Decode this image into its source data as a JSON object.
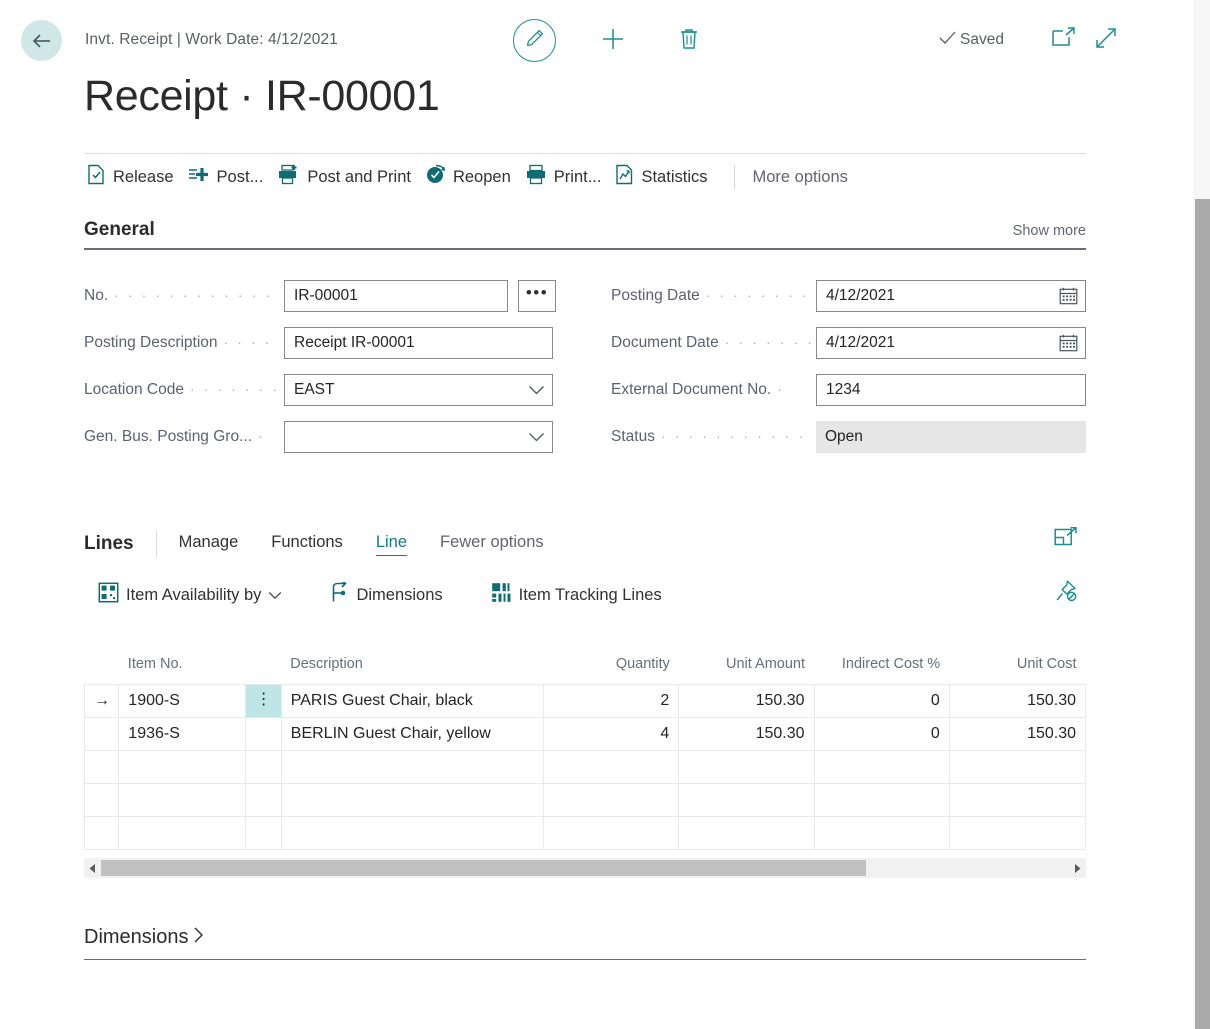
{
  "header": {
    "breadcrumb": "Invt. Receipt | Work Date: 4/12/2021",
    "title": "Receipt · IR-00001",
    "saved_label": "Saved",
    "back_icon": "back-arrow-icon",
    "edit_icon": "pencil-icon",
    "new_icon": "plus-icon",
    "delete_icon": "trash-icon",
    "open_new_window_icon": "open-in-new-window-icon",
    "fullscreen_icon": "expand-focus-icon"
  },
  "ribbon": {
    "actions": [
      {
        "label": "Release",
        "icon": "release-document-icon"
      },
      {
        "label": "Post...",
        "icon": "post-icon"
      },
      {
        "label": "Post and Print",
        "icon": "post-and-print-icon"
      },
      {
        "label": "Reopen",
        "icon": "reopen-icon"
      },
      {
        "label": "Print...",
        "icon": "printer-icon"
      },
      {
        "label": "Statistics",
        "icon": "statistics-icon"
      }
    ],
    "more_options": "More options"
  },
  "general": {
    "section_title": "General",
    "show_more": "Show more",
    "left_fields": [
      {
        "label": "No.",
        "value": "IR-00001",
        "type": "text-assist",
        "assist_label": "•••"
      },
      {
        "label": "Posting Description",
        "value": "Receipt IR-00001",
        "type": "text"
      },
      {
        "label": "Location Code",
        "value": "EAST",
        "type": "dropdown"
      },
      {
        "label": "Gen. Bus. Posting Gro...",
        "value": "",
        "type": "dropdown"
      }
    ],
    "right_fields": [
      {
        "label": "Posting Date",
        "value": "4/12/2021",
        "type": "date"
      },
      {
        "label": "Document Date",
        "value": "4/12/2021",
        "type": "date"
      },
      {
        "label": "External Document No.",
        "value": "1234",
        "type": "text"
      },
      {
        "label": "Status",
        "value": "Open",
        "type": "readonly"
      }
    ]
  },
  "lines": {
    "section_title": "Lines",
    "tabs": [
      {
        "label": "Manage",
        "active": false
      },
      {
        "label": "Functions",
        "active": false
      },
      {
        "label": "Line",
        "active": true
      },
      {
        "label": "Fewer options",
        "active": false,
        "muted": true
      }
    ],
    "toolbar": [
      {
        "label": "Item Availability by",
        "icon": "item-availability-icon",
        "has_chevron": true
      },
      {
        "label": "Dimensions",
        "icon": "dimensions-icon",
        "has_chevron": false
      },
      {
        "label": "Item Tracking Lines",
        "icon": "item-tracking-icon",
        "has_chevron": false
      }
    ],
    "open_grid_icon": "open-grid-in-new-window-icon",
    "unpin_icon": "unpin-icon",
    "columns": [
      {
        "key": "item_no",
        "label": "Item No.",
        "align": "left"
      },
      {
        "key": "description",
        "label": "Description",
        "align": "left"
      },
      {
        "key": "quantity",
        "label": "Quantity",
        "align": "right"
      },
      {
        "key": "unit_amount",
        "label": "Unit Amount",
        "align": "right"
      },
      {
        "key": "indirect_cost",
        "label": "Indirect Cost %",
        "align": "right"
      },
      {
        "key": "unit_cost",
        "label": "Unit Cost",
        "align": "right"
      }
    ],
    "rows": [
      {
        "selected": true,
        "item_no": "1900-S",
        "description": "PARIS Guest Chair, black",
        "quantity": "2",
        "unit_amount": "150.30",
        "indirect_cost": "0",
        "unit_cost": "150.30"
      },
      {
        "selected": false,
        "item_no": "1936-S",
        "description": "BERLIN Guest Chair, yellow",
        "quantity": "4",
        "unit_amount": "150.30",
        "indirect_cost": "0",
        "unit_cost": "150.30"
      },
      {
        "selected": false,
        "item_no": "",
        "description": "",
        "quantity": "",
        "unit_amount": "",
        "indirect_cost": "",
        "unit_cost": ""
      },
      {
        "selected": false,
        "item_no": "",
        "description": "",
        "quantity": "",
        "unit_amount": "",
        "indirect_cost": "",
        "unit_cost": ""
      },
      {
        "selected": false,
        "item_no": "",
        "description": "",
        "quantity": "",
        "unit_amount": "",
        "indirect_cost": "",
        "unit_cost": ""
      }
    ],
    "row_menu_glyph": "⋮",
    "row_indicator_glyph": "→"
  },
  "dimensions_section": {
    "title": "Dimensions",
    "chevron": "›"
  },
  "colors": {
    "accent_teal": "#127a81",
    "back_circle": "#cfe7e7",
    "selection_teal": "#bfe6e6",
    "section_rule": "#62707e",
    "readonly_bg": "#e6e6e6"
  }
}
